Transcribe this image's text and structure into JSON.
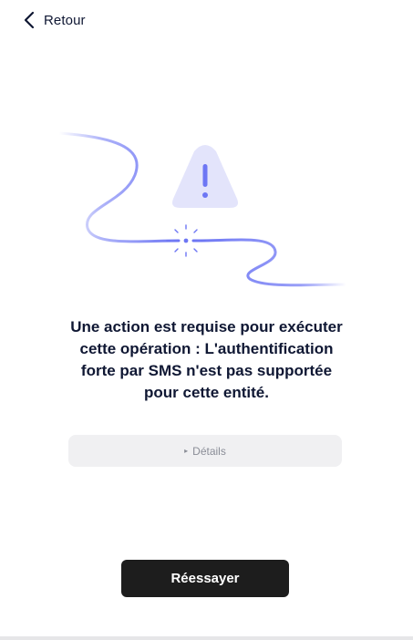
{
  "header": {
    "back_label": "Retour",
    "back_icon": "chevron-left-icon"
  },
  "illustration": {
    "warning_icon": "warning-triangle-icon",
    "spark_icon": "spark-icon",
    "triangle_color": "#e3e4fb",
    "exclamation_color": "#6d76f4",
    "wire_color": "#6d76f4"
  },
  "message": {
    "line1": "Une action est requise pour exécuter",
    "line2": "cette opération : L'authentification",
    "line3": "forte par SMS n'est pas supportée",
    "line4": "pour cette entité."
  },
  "details": {
    "toggle_icon": "▸",
    "label": "Détails"
  },
  "actions": {
    "retry_label": "Réessayer"
  },
  "colors": {
    "text": "#0f1733",
    "button_bg": "#1d1d1d",
    "details_bg": "#f0f0f2"
  }
}
